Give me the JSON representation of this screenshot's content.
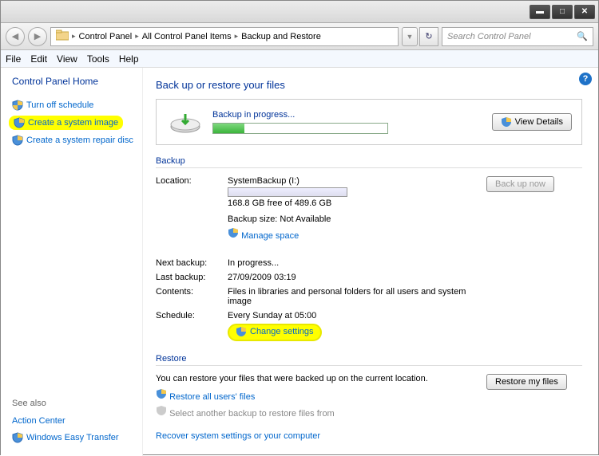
{
  "breadcrumb": {
    "a": "Control Panel",
    "b": "All Control Panel Items",
    "c": "Backup and Restore"
  },
  "search": {
    "placeholder": "Search Control Panel"
  },
  "menu": {
    "file": "File",
    "edit": "Edit",
    "view": "View",
    "tools": "Tools",
    "help": "Help"
  },
  "sidebar": {
    "home": "Control Panel Home",
    "turn_off": "Turn off schedule",
    "create_image": "Create a system image",
    "create_repair": "Create a system repair disc",
    "see_also": "See also",
    "action_center": "Action Center",
    "easy_transfer": "Windows Easy Transfer"
  },
  "main": {
    "title": "Back up or restore your files",
    "progress_label": "Backup in progress...",
    "view_details": "View Details",
    "backup_section": "Backup",
    "location_label": "Location:",
    "location_value": "SystemBackup (I:)",
    "free_space": "168.8 GB free of 489.6 GB",
    "backup_size": "Backup size: Not Available",
    "manage_space": "Manage space",
    "backup_now": "Back up now",
    "next_backup_label": "Next backup:",
    "next_backup_value": "In progress...",
    "last_backup_label": "Last backup:",
    "last_backup_value": "27/09/2009 03:19",
    "contents_label": "Contents:",
    "contents_value": "Files in libraries and personal folders for all users and system image",
    "schedule_label": "Schedule:",
    "schedule_value": "Every Sunday at 05:00",
    "change_settings": "Change settings",
    "restore_section": "Restore",
    "restore_text": "You can restore your files that were backed up on the current location.",
    "restore_all": "Restore all users' files",
    "select_another": "Select another backup to restore files from",
    "restore_my_files": "Restore my files",
    "recover_link": "Recover system settings or your computer"
  }
}
